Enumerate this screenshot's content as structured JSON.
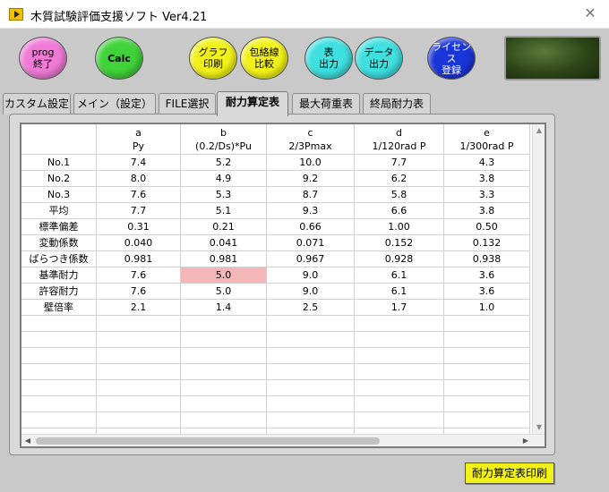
{
  "window": {
    "title": "木質試験評価支援ソフト Ver4.21",
    "close_glyph": "✕"
  },
  "toolbar": {
    "prog_label": "prog\n終了",
    "calc_label": "Calc",
    "graph_label": "グラフ\n印刷",
    "envelope_label": "包絡線\n比較",
    "table_label": "表\n出力",
    "data_label": "データ\n出力",
    "license_label": "ライセンス\n登録"
  },
  "tabs": [
    "カスタム設定",
    "メイン（設定）",
    "FILE選択",
    "耐力算定表",
    "最大荷重表",
    "終局耐力表"
  ],
  "table": {
    "columns": [
      {
        "letter": "a",
        "name": "Py"
      },
      {
        "letter": "b",
        "name": "(0.2/Ds)*Pu"
      },
      {
        "letter": "c",
        "name": "2/3Pmax"
      },
      {
        "letter": "d",
        "name": "1/120rad P"
      },
      {
        "letter": "e",
        "name": "1/300rad P"
      }
    ],
    "rows": [
      {
        "label": "No.1",
        "values": [
          "7.4",
          "5.2",
          "10.0",
          "7.7",
          "4.3"
        ]
      },
      {
        "label": "No.2",
        "values": [
          "8.0",
          "4.9",
          "9.2",
          "6.2",
          "3.8"
        ]
      },
      {
        "label": "No.3",
        "values": [
          "7.6",
          "5.3",
          "8.7",
          "5.8",
          "3.3"
        ]
      },
      {
        "label": "平均",
        "values": [
          "7.7",
          "5.1",
          "9.3",
          "6.6",
          "3.8"
        ]
      },
      {
        "label": "標準偏差",
        "values": [
          "0.31",
          "0.21",
          "0.66",
          "1.00",
          "0.50"
        ]
      },
      {
        "label": "変動係数",
        "values": [
          "0.040",
          "0.041",
          "0.071",
          "0.152",
          "0.132"
        ]
      },
      {
        "label": "ばらつき係数",
        "values": [
          "0.981",
          "0.981",
          "0.967",
          "0.928",
          "0.938"
        ]
      },
      {
        "label": "基準耐力",
        "values": [
          "7.6",
          "5.0",
          "9.0",
          "6.1",
          "3.6"
        ]
      },
      {
        "label": "許容耐力",
        "values": [
          "7.6",
          "5.0",
          "9.0",
          "6.1",
          "3.6"
        ]
      },
      {
        "label": "壁倍率",
        "values": [
          "2.1",
          "1.4",
          "2.5",
          "1.7",
          "1.0"
        ]
      }
    ],
    "highlight": {
      "row": 7,
      "col": 1,
      "color": "#f4b6b6"
    },
    "empty_rows": 8
  },
  "scrollbars": {
    "up": "▲",
    "down": "▼",
    "left": "◀",
    "right": "▶"
  },
  "footer": {
    "print_label": "耐力算定表印刷"
  }
}
